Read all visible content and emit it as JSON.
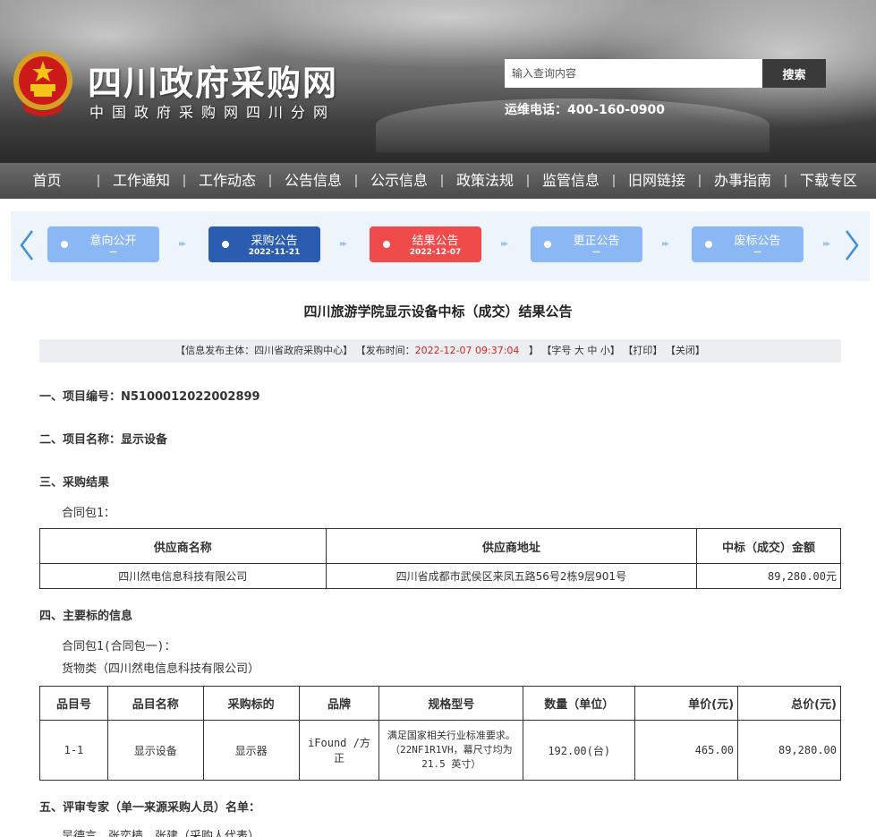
{
  "header": {
    "site_title": "四川政府采购网",
    "site_subtitle": "中国政府采购网四川分网",
    "search_placeholder": "输入查询内容",
    "search_button": "搜索",
    "hotline": "运维电话：400-160-0900"
  },
  "nav": {
    "items": [
      "首页",
      "工作通知",
      "工作动态",
      "公告信息",
      "公示信息",
      "政策法规",
      "监管信息",
      "旧网链接",
      "办事指南",
      "下载专区"
    ],
    "separator": "|"
  },
  "steps": {
    "items": [
      {
        "label": "意向公开",
        "date": "—",
        "state": "inactive"
      },
      {
        "label": "采购公告",
        "date": "2022-11-21",
        "state": "done"
      },
      {
        "label": "结果公告",
        "date": "2022-12-07",
        "state": "current"
      },
      {
        "label": "更正公告",
        "date": "—",
        "state": "inactive"
      },
      {
        "label": "废标公告",
        "date": "—",
        "state": "inactive"
      }
    ],
    "colors": {
      "inactive": "#8bb8f5",
      "done": "#2a5db0",
      "current": "#ef4b4b"
    }
  },
  "article": {
    "title": "四川旅游学院显示设备中标（成交）结果公告",
    "meta": {
      "publisher": "【信息发布主体：四川省政府采购中心】",
      "time_label": "【发布时间：",
      "time_value": "2022-12-07 09:37:04",
      "time_close": "】",
      "font_size_label": "【字号",
      "font_large": "大",
      "font_medium": "中",
      "font_small": "小",
      "font_close": "】",
      "print": "【打印】",
      "close": "【关闭】"
    },
    "section1": "一、项目编号：N5100012022002899",
    "section2": "二、项目名称：显示设备",
    "section3": "三、采购结果",
    "package1": "合同包1：",
    "result_table": {
      "headers": [
        "供应商名称",
        "供应商地址",
        "中标（成交）金额"
      ],
      "rows": [
        [
          "四川然电信息科技有限公司",
          "四川省成都市武侯区来凤五路56号2栋9层901号",
          "89,280.00元"
        ]
      ]
    },
    "section4": "四、主要标的信息",
    "package1_detail": "合同包1(合同包一)：",
    "goods_type": "货物类（四川然电信息科技有限公司）",
    "goods_table": {
      "headers": [
        "品目号",
        "品目名称",
        "采购标的",
        "品牌",
        "规格型号",
        "数量（单位）",
        "单价(元)",
        "总价(元)"
      ],
      "rows": [
        [
          "1-1",
          "显示设备",
          "显示器",
          "iFound /方正",
          "满足国家相关行业标准要求。（22NF1R1VH，幕尺寸均为 21.5 英寸）",
          "192.00(台)",
          "465.00",
          "89,280.00"
        ]
      ]
    },
    "section5": "五、评审专家（单一来源采购人员）名单：",
    "experts": "吴德言、张奕樯、张建（采购人代表）"
  }
}
